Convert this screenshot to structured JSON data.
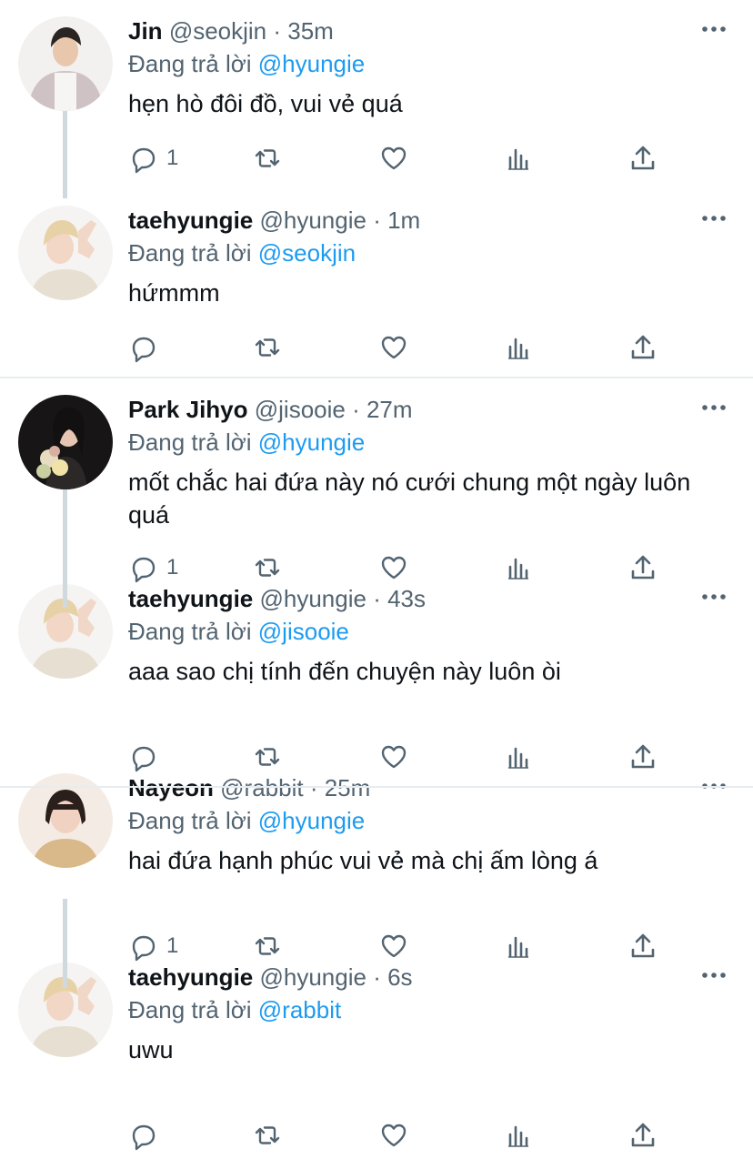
{
  "tweets": [
    {
      "name": "Jin",
      "handle": "@seokjin",
      "time": "35m",
      "reply_prefix": "Đang trả lời ",
      "reply_to": "@hyungie",
      "text": "hẹn hò đôi đồ, vui vẻ quá",
      "reply_count": "1",
      "avatar": "jin"
    },
    {
      "name": "taehyungie",
      "handle": "@hyungie",
      "time": "1m",
      "reply_prefix": "Đang trả lời ",
      "reply_to": "@seokjin",
      "text": "hứmmm",
      "reply_count": "",
      "avatar": "tae"
    },
    {
      "name": "Park Jihyo",
      "handle": "@jisooie",
      "time": "27m",
      "reply_prefix": "Đang trả lời ",
      "reply_to": "@hyungie",
      "text": "mốt chắc hai đứa này nó cưới chung một ngày luôn quá",
      "reply_count": "1",
      "avatar": "jihyo"
    },
    {
      "name": "taehyungie",
      "handle": "@hyungie",
      "time": "43s",
      "reply_prefix": "Đang trả lời ",
      "reply_to": "@jisooie",
      "text": "aaa sao chị tính đến chuyện này luôn òi",
      "reply_count": "",
      "avatar": "tae"
    },
    {
      "name": "Nayeon",
      "handle": "@rabbit",
      "time": "25m",
      "reply_prefix": "Đang trả lời ",
      "reply_to": "@hyungie",
      "text": "hai đứa hạnh phúc vui vẻ mà chị ấm lòng á",
      "reply_count": "1",
      "avatar": "nayeon"
    },
    {
      "name": "taehyungie",
      "handle": "@hyungie",
      "time": "6s",
      "reply_prefix": "Đang trả lời ",
      "reply_to": "@rabbit",
      "text": "uwu",
      "reply_count": "",
      "avatar": "tae"
    }
  ],
  "sep": " · ",
  "icons": {
    "reply": "reply-icon",
    "retweet": "retweet-icon",
    "like": "heart-icon",
    "views": "analytics-icon",
    "share": "share-icon",
    "more": "more-icon"
  },
  "colors": {
    "mention": "#1d9bf0",
    "meta": "#536471",
    "divider": "#e6ecf0",
    "thread_line": "#cfd9de"
  }
}
